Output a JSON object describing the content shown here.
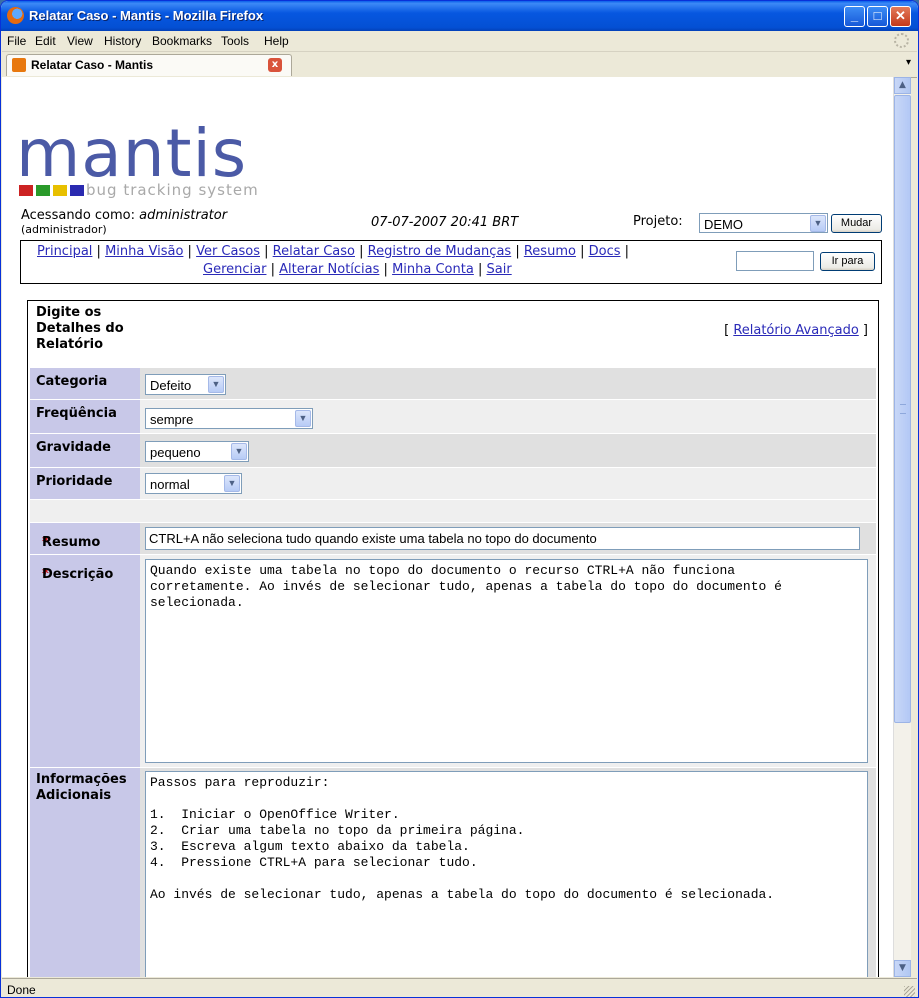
{
  "window": {
    "title": "Relatar Caso - Mantis - Mozilla Firefox",
    "buttons": {
      "minimize": "_",
      "maximize": "□",
      "close": "✕"
    }
  },
  "menu": [
    "File",
    "Edit",
    "View",
    "History",
    "Bookmarks",
    "Tools",
    "Help"
  ],
  "tab": {
    "label": "Relatar Caso - Mantis",
    "close": "x",
    "list_arrow": "▾"
  },
  "status": "Done",
  "logo": {
    "word": "mantis",
    "tagline": "bug tracking system",
    "colors": [
      "#cc2222",
      "#2a9a2a",
      "#e8c000",
      "#2a2ab0"
    ]
  },
  "login": {
    "prefix": "Acessando como: ",
    "user": "administrator",
    "role": "(administrador)"
  },
  "datetime": "07-07-2007 20:41 BRT",
  "project": {
    "label": "Projeto:",
    "selected": "DEMO",
    "button": "Mudar"
  },
  "nav": {
    "row1": [
      "Principal",
      "Minha Visão",
      "Ver Casos",
      "Relatar Caso",
      "Registro de Mudanças",
      "Resumo",
      "Docs"
    ],
    "row2": [
      "Gerenciar",
      "Alterar Notícias",
      "Minha Conta",
      "Sair"
    ],
    "separator": "|",
    "goto_button": "Ir para",
    "goto_value": ""
  },
  "form": {
    "title": "Digite os Detalhes do Relatório",
    "advanced": {
      "open": "[",
      "label": "Relatório Avançado",
      "close": "]"
    },
    "category": {
      "label": "Categoria",
      "value": "Defeito"
    },
    "frequency": {
      "label": "Freqüência",
      "value": "sempre"
    },
    "severity": {
      "label": "Gravidade",
      "value": "pequeno"
    },
    "priority": {
      "label": "Prioridade",
      "value": "normal"
    },
    "summary": {
      "required_mark": "*",
      "label": "Resumo",
      "value": "CTRL+A não seleciona tudo quando existe uma tabela no topo do documento"
    },
    "description": {
      "required_mark": "*",
      "label": "Descrição",
      "lines": [
        "Quando existe uma tabela no topo do documento o recurso CTRL+A não funciona",
        "corretamente. Ao invés de selecionar tudo, apenas a tabela do topo do documento é",
        "selecionada."
      ]
    },
    "additional": {
      "label": "Informações Adicionais",
      "lines": [
        "Passos para reproduzir:",
        "",
        "1.  Iniciar o OpenOffice Writer.",
        "2.  Criar uma tabela no topo da primeira página.",
        "3.  Escreva algum texto abaixo da tabela.",
        "4.  Pressione CTRL+A para selecionar tudo.",
        "",
        "Ao invés de selecionar tudo, apenas a tabela do topo do documento é selecionada."
      ]
    }
  }
}
